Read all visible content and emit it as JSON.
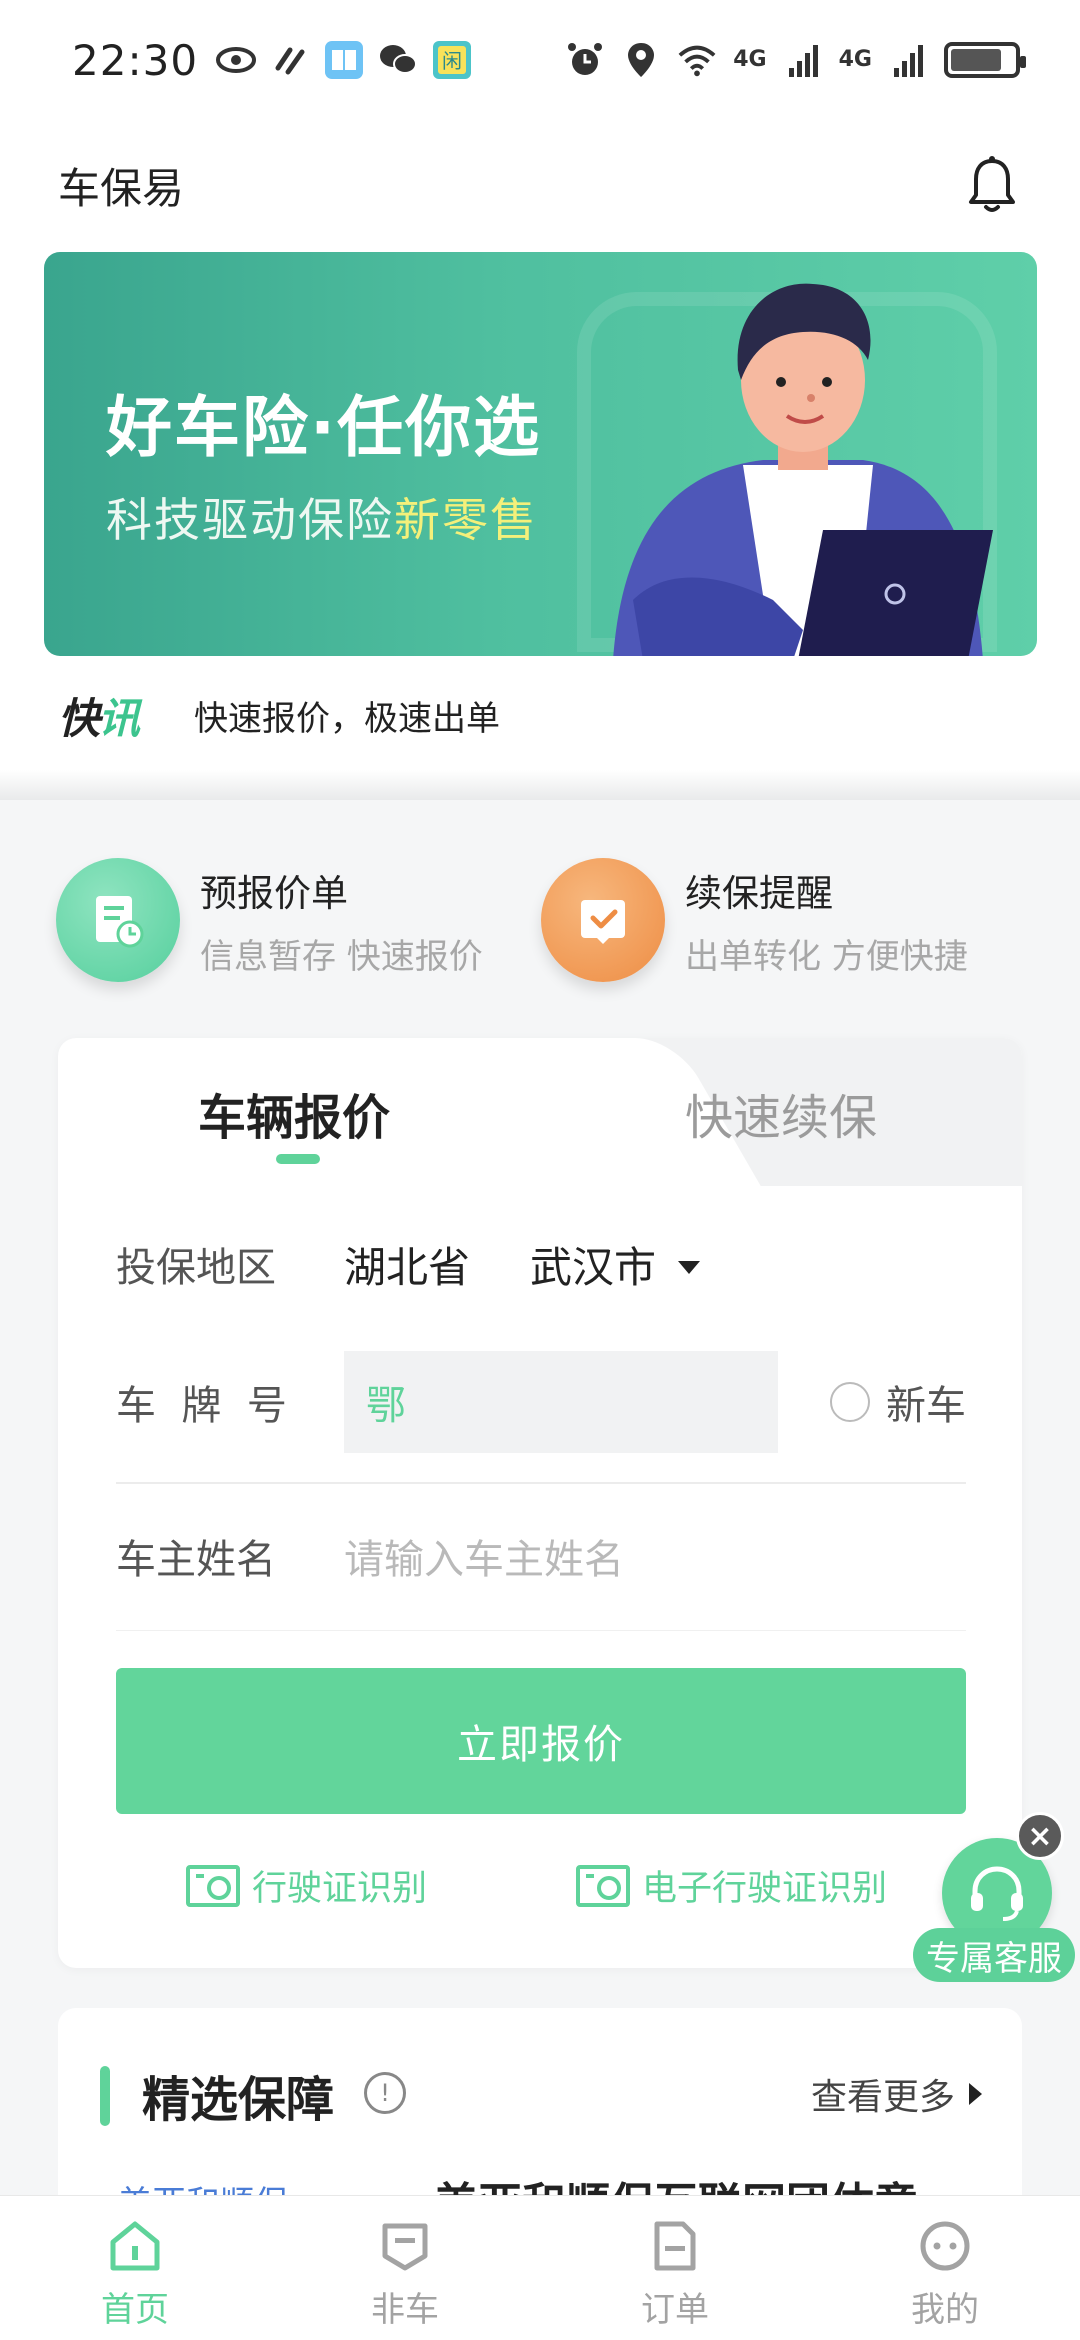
{
  "status_bar": {
    "time": "22:30",
    "left_icons": [
      "eye-icon",
      "link-icon",
      "book-app-icon",
      "wechat-icon",
      "xianyu-app-icon"
    ],
    "right_icons": [
      "alarm-icon",
      "location-icon",
      "wifi-icon",
      "signal-4g-icon",
      "signal-4g-icon",
      "battery-icon"
    ],
    "net1": "4G",
    "net2": "4G"
  },
  "header": {
    "title": "车保易",
    "bell_icon": "bell-icon"
  },
  "banner": {
    "title": "好车险·任你选",
    "subtitle_prefix": "科技驱动保险",
    "subtitle_highlight": "新零售"
  },
  "news": {
    "tag_prefix": "快",
    "tag_suffix": "讯",
    "text": "快速报价，极速出单"
  },
  "quick_actions": [
    {
      "title": "预报价单",
      "subtitle": "信息暂存 快速报价",
      "icon": "document-clock-icon",
      "color": "#5fd39a"
    },
    {
      "title": "续保提醒",
      "subtitle": "出单转化 方便快捷",
      "icon": "checkmark-card-icon",
      "color": "#ef9146"
    }
  ],
  "quote_card": {
    "tabs": [
      {
        "label": "车辆报价",
        "active": true
      },
      {
        "label": "快速续保",
        "active": false
      }
    ],
    "region_label": "投保地区",
    "province": "湖北省",
    "city": "武汉市",
    "plate_label": "车  牌  号",
    "plate_prefix": "鄂",
    "new_car_label": "新车",
    "owner_label": "车主姓名",
    "owner_placeholder": "请输入车主姓名",
    "quote_button": "立即报价",
    "ocr_1": "行驶证识别",
    "ocr_2": "电子行驶证识别"
  },
  "customer_service": {
    "label": "专属客服",
    "close": "×"
  },
  "featured": {
    "title": "精选保障",
    "more": "查看更多",
    "item_brand": "美亚和顺保",
    "item_title": "美亚和顺保互联网团体意"
  },
  "bottom_nav": [
    {
      "label": "首页",
      "icon": "home-icon",
      "active": true
    },
    {
      "label": "非车",
      "icon": "shield-tag-icon",
      "active": false
    },
    {
      "label": "订单",
      "icon": "order-icon",
      "active": false
    },
    {
      "label": "我的",
      "icon": "profile-icon",
      "active": false
    }
  ],
  "colors": {
    "accent": "#5fd39a",
    "orange": "#ef9146",
    "banner_start": "#3aa58e",
    "banner_end": "#5fcfa9"
  }
}
